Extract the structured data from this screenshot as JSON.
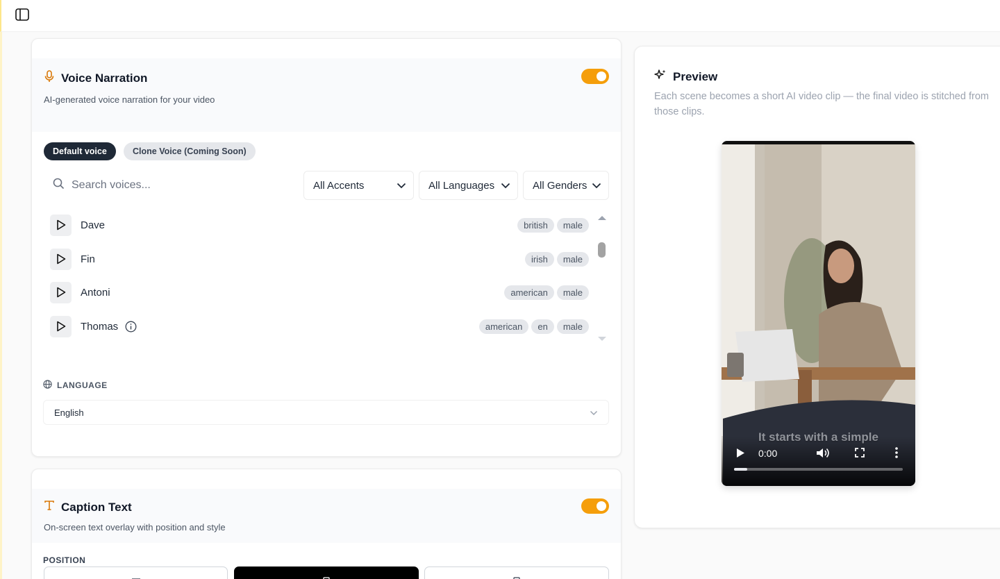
{
  "voice_narration": {
    "title": "Voice Narration",
    "subtitle": "AI-generated voice narration for your video",
    "enabled": true,
    "tabs": {
      "default": "Default voice",
      "clone": "Clone Voice (Coming Soon)"
    },
    "search_placeholder": "Search voices...",
    "filters": {
      "accents": "All Accents",
      "languages": "All Languages",
      "genders": "All Genders"
    },
    "voices": [
      {
        "name": "Dave",
        "tags": [
          "british",
          "male"
        ]
      },
      {
        "name": "Fin",
        "tags": [
          "irish",
          "male"
        ]
      },
      {
        "name": "Antoni",
        "tags": [
          "american",
          "male"
        ]
      },
      {
        "name": "Thomas",
        "tags": [
          "american",
          "en",
          "male"
        ]
      }
    ],
    "language_label": "LANGUAGE",
    "language_value": "English"
  },
  "caption_text": {
    "title": "Caption Text",
    "subtitle": "On-screen text overlay with position and style",
    "enabled": true,
    "position_label": "POSITION"
  },
  "preview": {
    "title": "Preview",
    "description": "Each scene becomes a short AI video clip — the final video is stitched from those clips.",
    "video": {
      "caption": "It starts with a simple",
      "time": "0:00",
      "progress": 0.08
    }
  },
  "colors": {
    "accent": "#f59e0b",
    "dark": "#1f2937"
  }
}
